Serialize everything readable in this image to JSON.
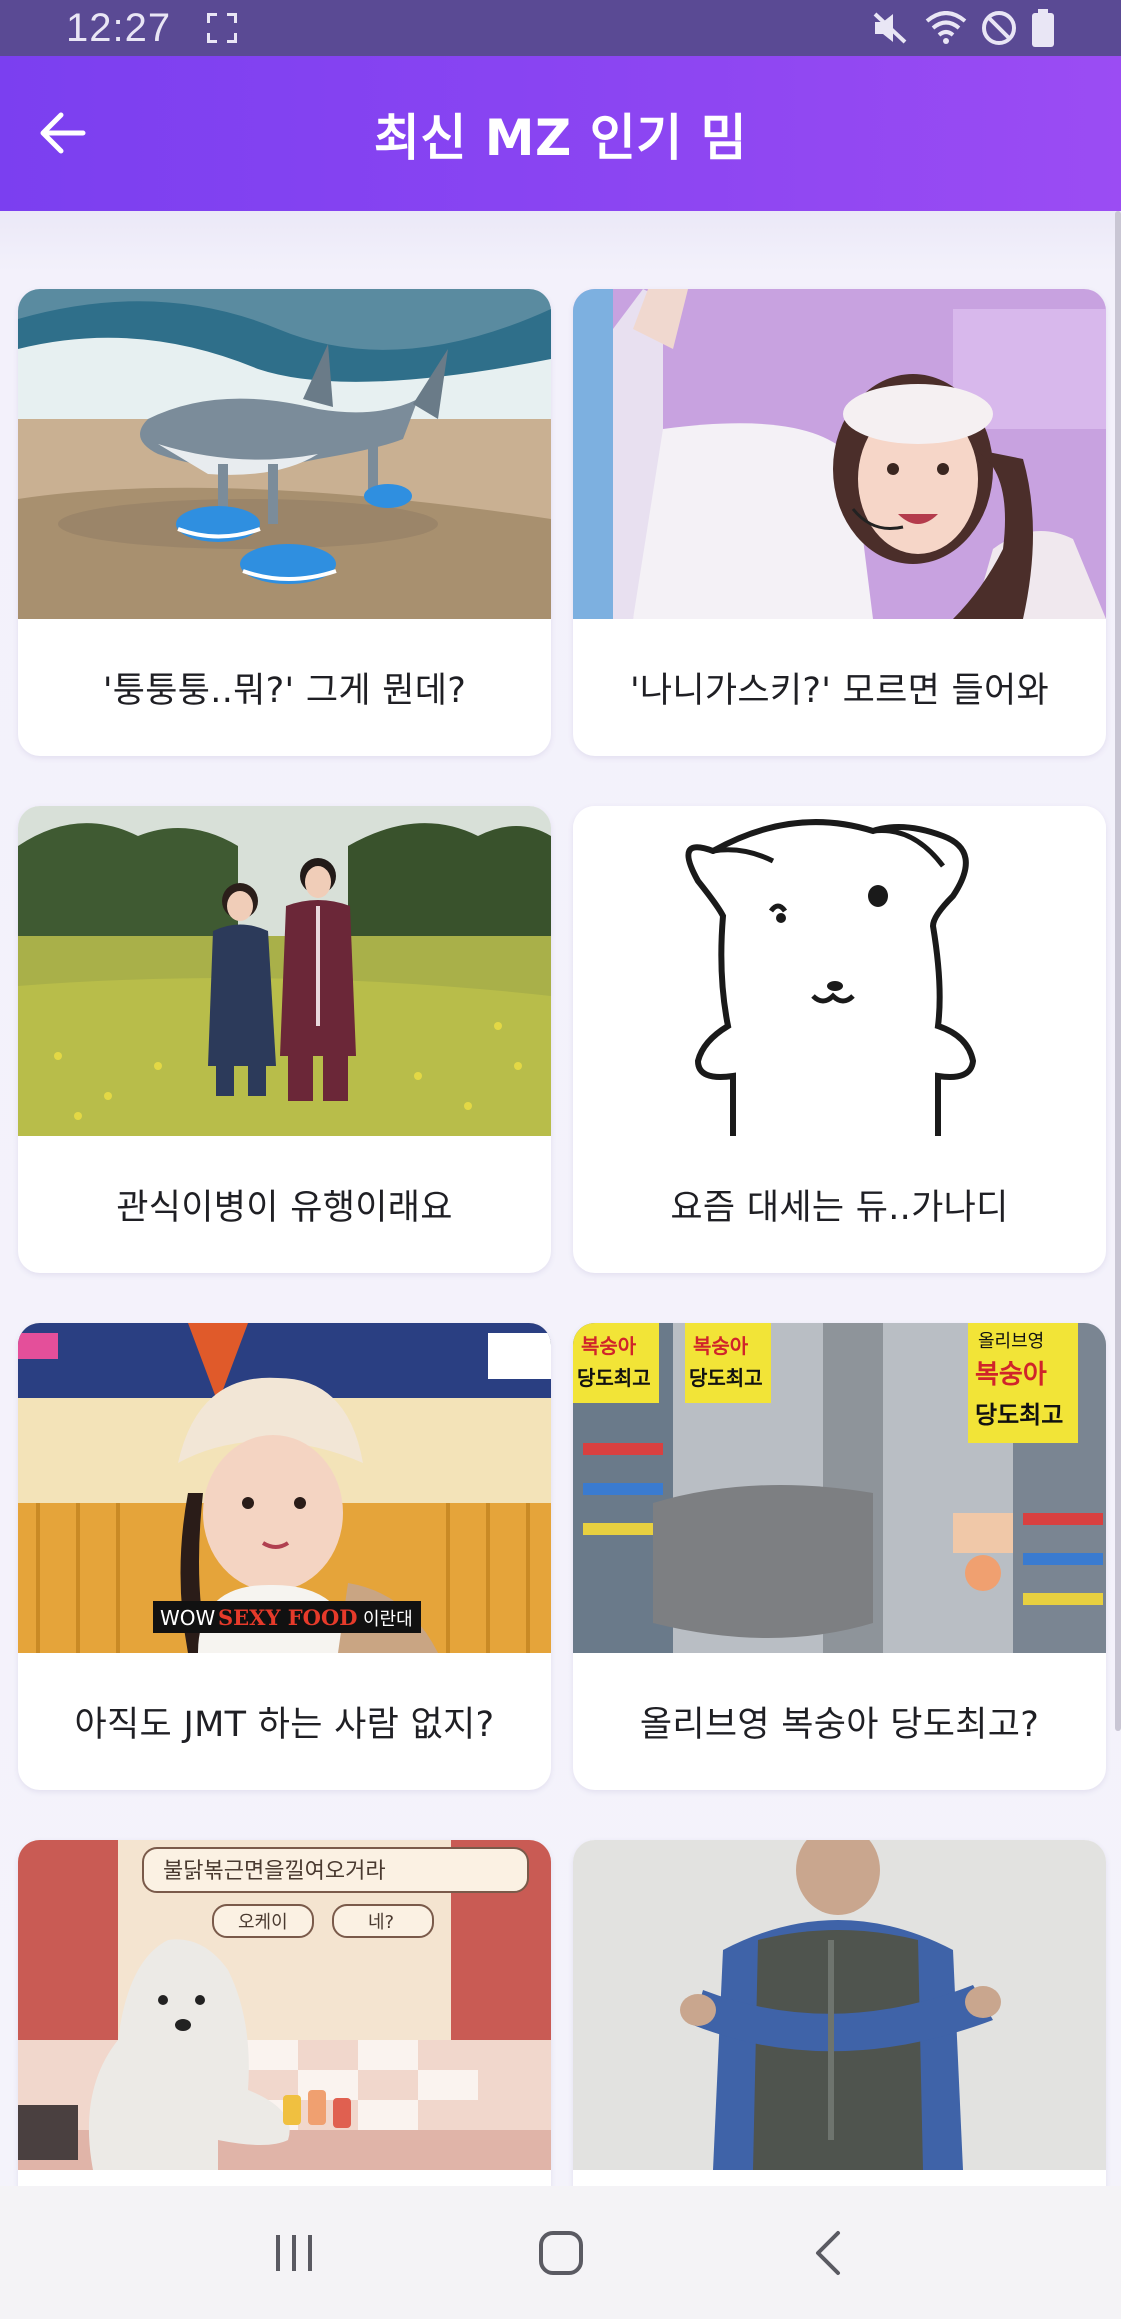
{
  "status_bar": {
    "time": "12:27",
    "icons": [
      "screen-capture-icon",
      "mute-icon",
      "wifi-icon",
      "do-not-disturb-icon",
      "battery-icon"
    ]
  },
  "app_bar": {
    "back_icon": "arrow-left-icon",
    "title": "최신 MZ 인기 밈"
  },
  "memes": [
    {
      "title": "'퉁퉁퉁..뭐?' 그게 뭔데?",
      "image": "shark-in-sneakers-on-beach"
    },
    {
      "title": "'나니가스키?' 모르면 들어와",
      "image": "idol-with-headset-mic"
    },
    {
      "title": "관식이병이 유행이래요",
      "image": "couple-in-flower-field"
    },
    {
      "title": "요즘 대세는 듀..가나디",
      "image": "line-drawing-puppy"
    },
    {
      "title": "아직도 JMT 하는 사람 없지?",
      "image": "woman-in-cap-with-caption"
    },
    {
      "title": "올리브영 복숭아 당도최고?",
      "image": "store-with-peach-signs"
    },
    {
      "title": "",
      "image": "puppy-at-counter-with-speech-bubble"
    },
    {
      "title": "",
      "image": "man-in-vest-dancing"
    }
  ],
  "image_text": {
    "caption_wow": "WOW",
    "caption_sexy": "SEXY FOOD",
    "caption_end": "이란대",
    "sign_peach": "복숭아",
    "sign_sweet": "당도최고",
    "sign_brand": "올리브영",
    "bubble_main": "불닭볶근면을낄여오거라",
    "bubble_ok": "오케이",
    "bubble_yes": "네?"
  },
  "nav_bar": {
    "buttons": [
      "recent-apps-icon",
      "home-icon",
      "back-icon"
    ]
  },
  "colors": {
    "status_bar": "#5a4a94",
    "app_bar_start": "#7b3ff0",
    "app_bar_end": "#9b4cf3",
    "background": "#f3f1fb",
    "card": "#ffffff"
  }
}
